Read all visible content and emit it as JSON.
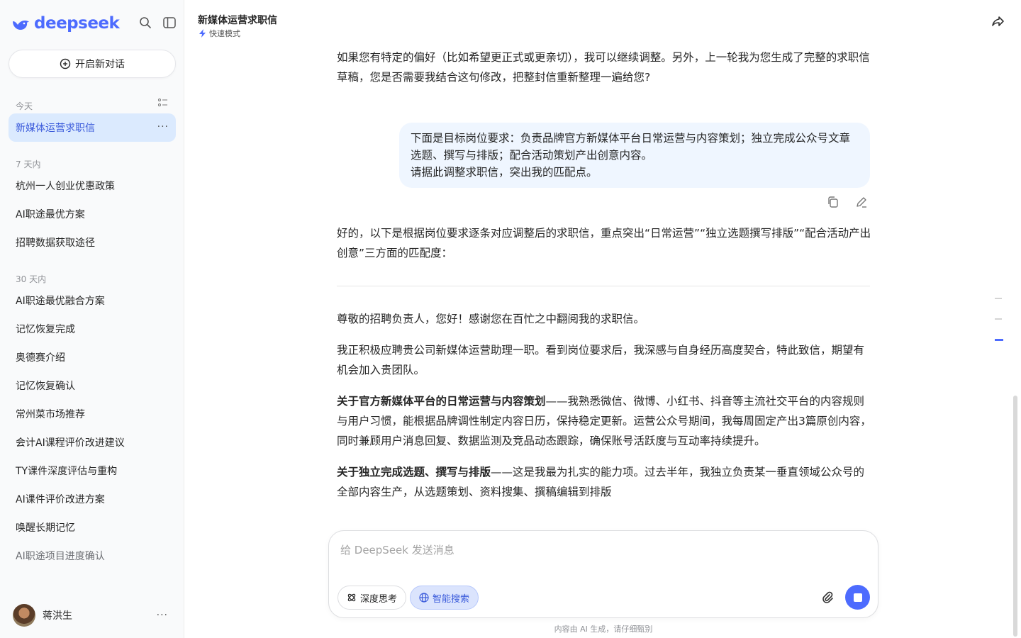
{
  "sidebar": {
    "brand": "deepseek",
    "new_chat_label": "开启新对话",
    "sections": [
      {
        "label": "今天",
        "items": [
          "新媒体运营求职信"
        ]
      },
      {
        "label": "7 天内",
        "items": [
          "杭州一人创业优惠政策",
          "AI职途最优方案",
          "招聘数据获取途径"
        ]
      },
      {
        "label": "30 天内",
        "items": [
          "AI职途最优融合方案",
          "记忆恢复完成",
          "奥德赛介绍",
          "记忆恢复确认",
          "常州菜市场推荐",
          "会计AI课程评价改进建议",
          "TY课件深度评估与重构",
          "AI课件评价改进方案",
          "唤醒长期记忆",
          "AI职途项目进度确认"
        ]
      }
    ],
    "user_name": "蒋洪生",
    "more_label": "···"
  },
  "header": {
    "title": "新媒体运营求职信",
    "mode": "快速模式"
  },
  "chat": {
    "prev_assistant": "如果您有特定的偏好（比如希望更正式或更亲切），我可以继续调整。另外，上一轮我为您生成了完整的求职信草稿，您是否需要我结合这句修改，把整封信重新整理一遍给您?",
    "user_line1": "下面是目标岗位要求：负责品牌官方新媒体平台日常运营与内容策划；独立完成公众号文章选题、撰写与排版；配合活动策划产出创意内容。",
    "user_line2": "请据此调整求职信，突出我的匹配点。",
    "reply_intro": "好的，以下是根据岗位要求逐条对应调整后的求职信，重点突出“日常运营”“独立选题撰写排版”“配合活动产出创意”三方面的匹配度：",
    "letter_greeting": "尊敬的招聘负责人，您好！感谢您在百忙之中翻阅我的求职信。",
    "letter_p1": "我正积极应聘贵公司新媒体运营助理一职。看到岗位要求后，我深感与自身经历高度契合，特此致信，期望有机会加入贵团队。",
    "letter_p2_bold": "关于官方新媒体平台的日常运营与内容策划",
    "letter_p2": "——我熟悉微信、微博、小红书、抖音等主流社交平台的内容规则与用户习惯，能根据品牌调性制定内容日历，保持稳定更新。运营公众号期间，我每周固定产出3篇原创内容，同时兼顾用户消息回复、数据监测及竞品动态跟踪，确保账号活跃度与互动率持续提升。",
    "letter_p3_bold": "关于独立完成选题、撰写与排版",
    "letter_p3": "——这是我最为扎实的能力项。过去半年，我独立负责某一垂直领域公众号的全部内容生产，从选题策划、资料搜集、撰稿编辑到排版"
  },
  "composer": {
    "placeholder": "给 DeepSeek 发送消息",
    "deep_think": "深度思考",
    "smart_search": "智能搜索",
    "disclaimer": "内容由 AI 生成，请仔细甄别"
  },
  "colors": {
    "accent": "#4d6bfe",
    "active_bg": "#dbeafe",
    "bubble_bg": "#eff6ff"
  }
}
